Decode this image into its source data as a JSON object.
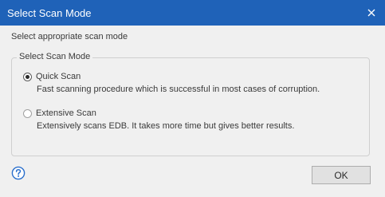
{
  "window": {
    "title": "Select Scan Mode",
    "close_icon": "close-icon",
    "titlebar_color": "#1f62b8"
  },
  "intro_text": "Select appropriate scan mode",
  "group": {
    "legend": "Select Scan Mode",
    "options": [
      {
        "label": "Quick Scan",
        "description": "Fast scanning procedure which is successful in most cases of corruption.",
        "selected": true
      },
      {
        "label": "Extensive Scan",
        "description": "Extensively scans EDB. It takes more time but gives better results.",
        "selected": false
      }
    ]
  },
  "footer": {
    "help_icon": "help-icon",
    "ok_label": "OK"
  }
}
